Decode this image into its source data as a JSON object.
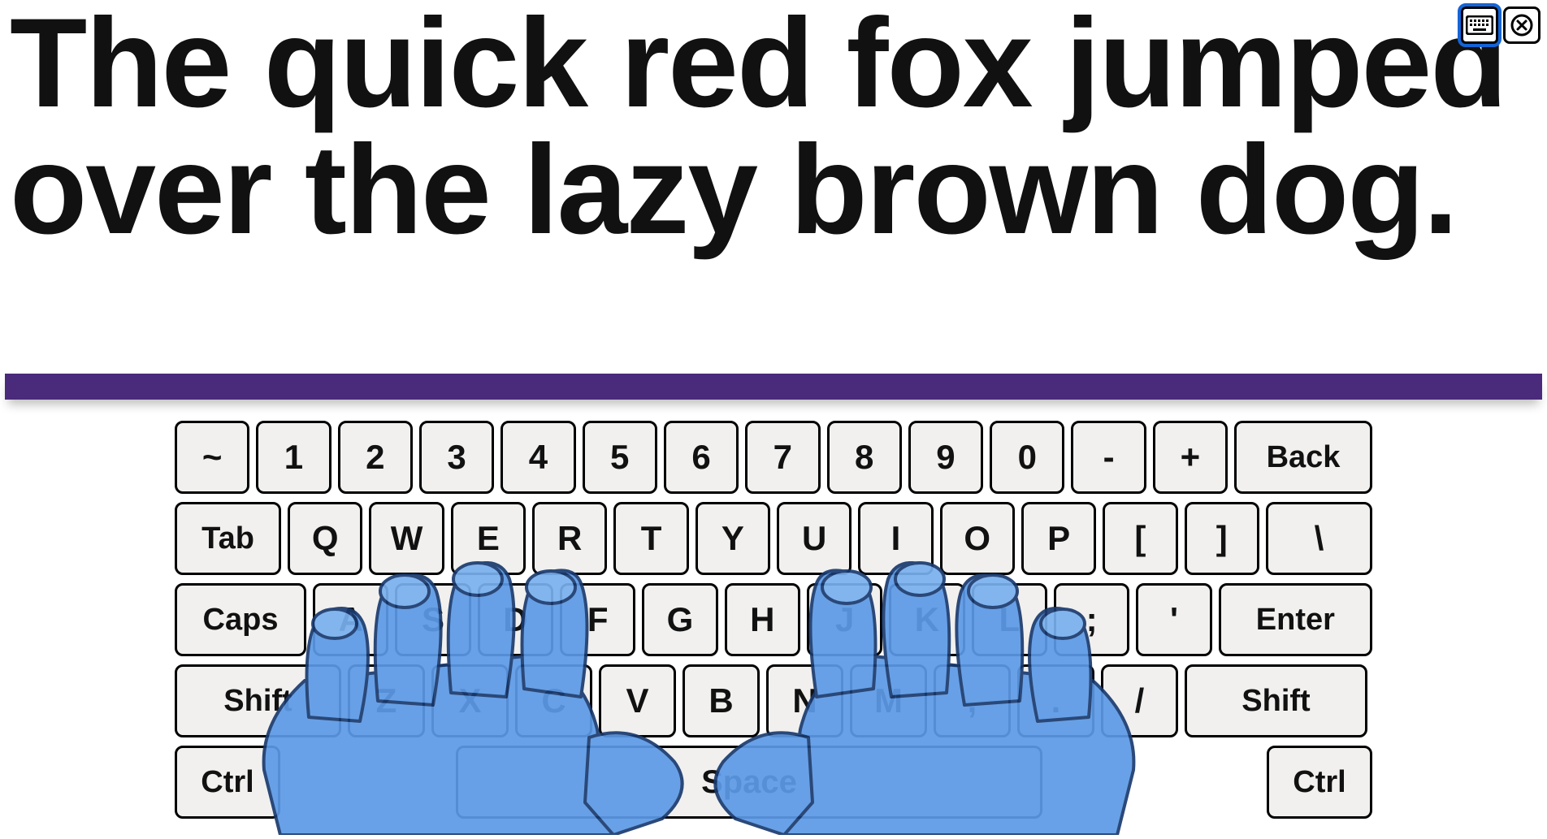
{
  "text": "The quick red fox jumped over the lazy brown dog.",
  "separator_color": "#4a2a7a",
  "toolbar": {
    "keyboard_toggle_active": true
  },
  "keyboard": {
    "row1": [
      "~",
      "1",
      "2",
      "3",
      "4",
      "5",
      "6",
      "7",
      "8",
      "9",
      "0",
      "-",
      "+",
      "Back"
    ],
    "row2": [
      "Tab",
      "Q",
      "W",
      "E",
      "R",
      "T",
      "Y",
      "U",
      "I",
      "O",
      "P",
      "[",
      "]",
      "\\"
    ],
    "row3": [
      "Caps",
      "A",
      "S",
      "D",
      "F",
      "G",
      "H",
      "J",
      "K",
      "L",
      ";",
      "'",
      "Enter"
    ],
    "row4": [
      "Shift",
      "Z",
      "X",
      "C",
      "V",
      "B",
      "N",
      "M",
      ",",
      ".",
      "/",
      "Shift"
    ],
    "row5": {
      "ctrl_l": "Ctrl",
      "space": "Space",
      "ctrl_r": "Ctrl"
    }
  }
}
